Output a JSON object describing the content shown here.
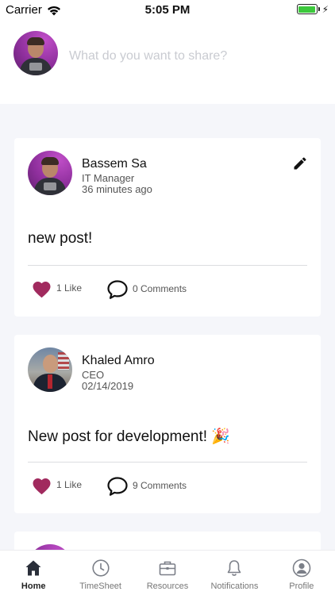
{
  "status_bar": {
    "carrier": "Carrier",
    "time": "5:05 PM"
  },
  "composer": {
    "placeholder": "What do you want to share?"
  },
  "posts": [
    {
      "author": "Bassem Sa",
      "role": "IT Manager",
      "time": "36 minutes ago",
      "text": "new post!",
      "likes_label": "1 Like",
      "comments_label": "0 Comments"
    },
    {
      "author": "Khaled Amro",
      "role": "CEO",
      "time": "02/14/2019",
      "text": "New post for development! 🎉",
      "likes_label": "1 Like",
      "comments_label": "9 Comments"
    }
  ],
  "tabs": [
    {
      "label": "Home",
      "icon": "home-icon",
      "active": true
    },
    {
      "label": "TimeSheet",
      "icon": "clock-icon",
      "active": false
    },
    {
      "label": "Resources",
      "icon": "briefcase-icon",
      "active": false
    },
    {
      "label": "Notifications",
      "icon": "bell-icon",
      "active": false
    },
    {
      "label": "Profile",
      "icon": "profile-icon",
      "active": false
    }
  ],
  "colors": {
    "like_heart": "#a12a5e",
    "battery": "#3cc83c",
    "background": "#f5f6fa",
    "avatar_purple": "#8e2f9c"
  }
}
